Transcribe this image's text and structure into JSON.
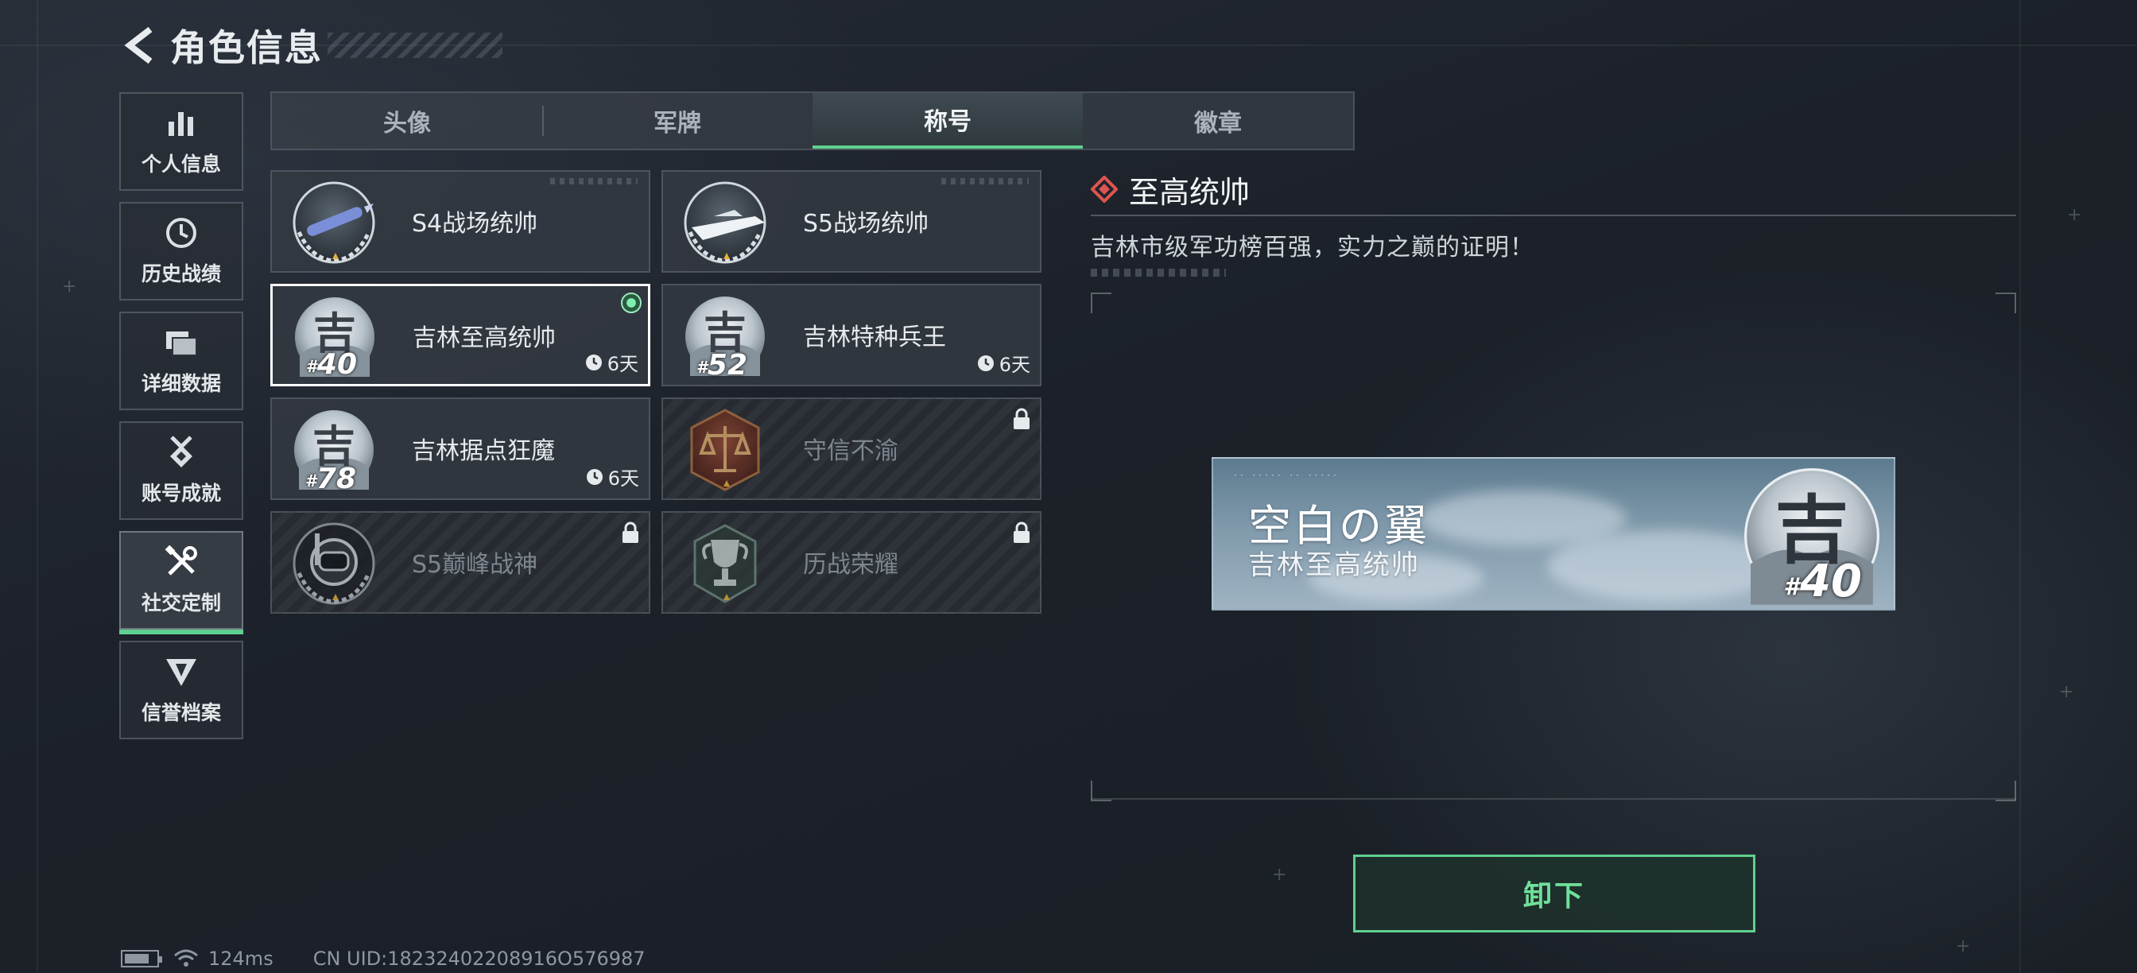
{
  "header": {
    "title": "角色信息",
    "back_icon": "chevron-left-icon"
  },
  "sidebar": {
    "items": [
      {
        "label": "个人信息",
        "icon": "bar-chart-icon",
        "active": false
      },
      {
        "label": "历史战绩",
        "icon": "history-clock-icon",
        "active": false
      },
      {
        "label": "详细数据",
        "icon": "folders-icon",
        "active": false
      },
      {
        "label": "账号成就",
        "icon": "achievement-medal-icon",
        "active": false
      },
      {
        "label": "社交定制",
        "icon": "tools-icon",
        "active": true
      },
      {
        "label": "信誉档案",
        "icon": "reputation-badge-icon",
        "active": false
      }
    ]
  },
  "tabs": [
    {
      "label": "头像",
      "active": false
    },
    {
      "label": "军牌",
      "active": false
    },
    {
      "label": "称号",
      "active": true
    },
    {
      "label": "徽章",
      "active": false
    }
  ],
  "titles": [
    {
      "name": "S4战场统帅",
      "emblem": "missile-emblem-icon",
      "locked": false
    },
    {
      "name": "S5战场统帅",
      "emblem": "speedboat-emblem-icon",
      "locked": false
    },
    {
      "name": "吉林至高统帅",
      "emblem": "ji-province-emblem-icon",
      "rank": "40",
      "timer": "6天",
      "selected": true,
      "equipped": true
    },
    {
      "name": "吉林特种兵王",
      "emblem": "ji-province-emblem-icon",
      "rank": "52",
      "timer": "6天"
    },
    {
      "name": "吉林据点狂魔",
      "emblem": "ji-province-emblem-icon",
      "rank": "78",
      "timer": "6天"
    },
    {
      "name": "守信不渝",
      "emblem": "scales-emblem-icon",
      "locked": true
    },
    {
      "name": "S5巅峰战神",
      "emblem": "diver-helmet-emblem-icon",
      "locked": true
    },
    {
      "name": "历战荣耀",
      "emblem": "trophy-emblem-icon",
      "locked": true
    }
  ],
  "rank_prefix": "#",
  "detail": {
    "title": "至高统帅",
    "description": "吉林市级军功榜百强，实力之巅的证明！"
  },
  "banner": {
    "player_name": "空白の翼",
    "title_name": "吉林至高统帅",
    "rank": "40",
    "emblem_char": "吉"
  },
  "actions": {
    "unequip_label": "卸下"
  },
  "status_bar": {
    "ping": "124ms",
    "uid": "CN UID:18232402208916O576987"
  },
  "colors": {
    "accent_green": "#5fd08f",
    "detail_diamond": "#e0544f"
  }
}
